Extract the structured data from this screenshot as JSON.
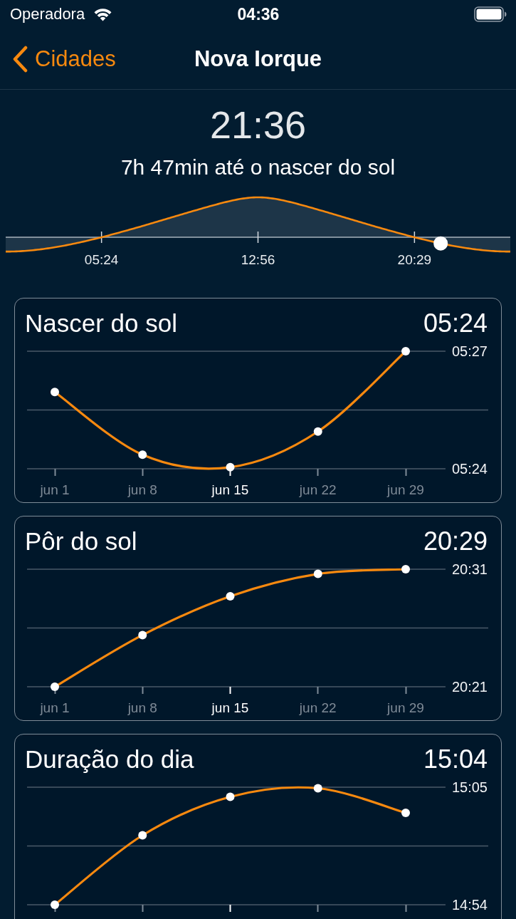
{
  "status_bar": {
    "carrier": "Operadora",
    "time": "04:36"
  },
  "nav_bar": {
    "back_label": "Cidades",
    "title": "Nova Iorque"
  },
  "header": {
    "current_time": "21:36",
    "countdown": "7h 47min até o nascer do sol"
  },
  "sun_path": {
    "labels": [
      "05:24",
      "12:56",
      "20:29"
    ],
    "level": 0.862
  },
  "cards": [
    {
      "title": "Nascer do sol",
      "value": "05:24",
      "x_ticks": [
        {
          "selected": false
        },
        {
          "selected": false
        },
        {
          "selected": true
        },
        {
          "selected": false
        },
        {
          "selected": false
        }
      ],
      "chart_data": {
        "type": "line",
        "marker": "o",
        "categories": [
          "jun 1",
          "jun 8",
          "jun 15",
          "jun 22",
          "jun 29"
        ],
        "values": [
          325.96,
          324.36,
          324.04,
          324.95,
          327
        ],
        "ylim": [
          324,
          327
        ],
        "yticks": [
          {
            "value": 324,
            "label": "05:24"
          },
          {
            "value": 327,
            "label": "05:27"
          }
        ]
      }
    },
    {
      "title": "Pôr do sol",
      "value": "20:29",
      "x_ticks": [
        {
          "selected": false
        },
        {
          "selected": false
        },
        {
          "selected": true
        },
        {
          "selected": false
        },
        {
          "selected": false
        }
      ],
      "chart_data": {
        "type": "line",
        "marker": "o",
        "categories": [
          "jun 1",
          "jun 8",
          "jun 15",
          "jun 22",
          "jun 29"
        ],
        "values": [
          1221,
          1225.4,
          1228.7,
          1230.6,
          1231
        ],
        "ylim": [
          1221,
          1231
        ],
        "yticks": [
          {
            "value": 1221,
            "label": "20:21"
          },
          {
            "value": 1231,
            "label": "20:31"
          }
        ]
      }
    },
    {
      "title": "Duração do dia",
      "value": "15:04",
      "x_ticks": [
        {
          "selected": false
        },
        {
          "selected": false
        },
        {
          "selected": true
        },
        {
          "selected": false
        },
        {
          "selected": false
        }
      ],
      "chart_data": {
        "type": "line",
        "marker": "o",
        "values": [
          894,
          900.5,
          904.1,
          904.9,
          902.6
        ],
        "ylim": [
          894,
          905
        ],
        "yticks": [
          {
            "value": 894,
            "label": "14:54"
          },
          {
            "value": 905,
            "label": "15:05"
          }
        ]
      }
    }
  ]
}
